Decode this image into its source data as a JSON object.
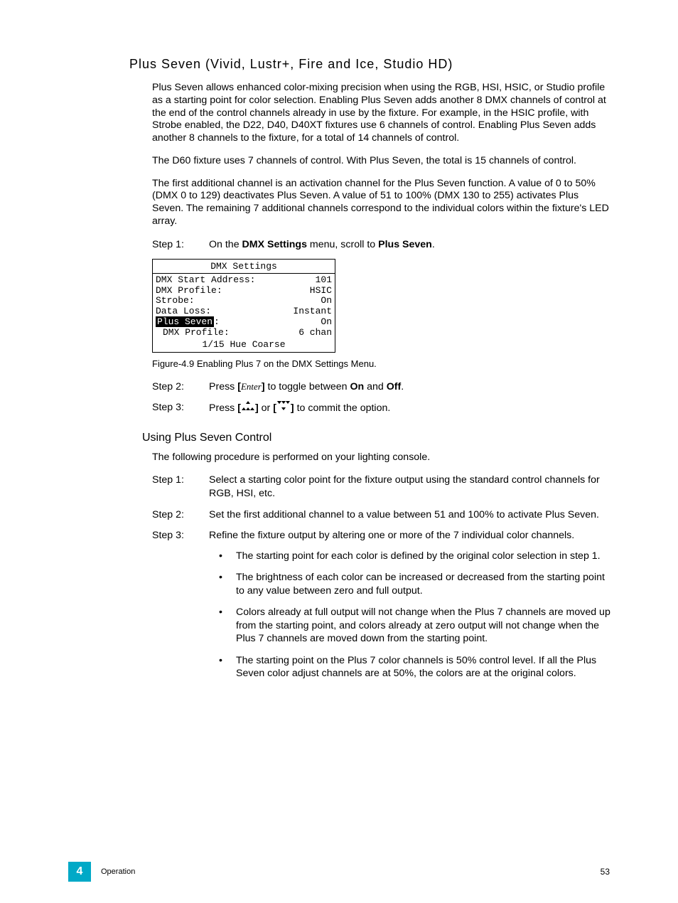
{
  "section_title": "Plus Seven (Vivid, Lustr+, Fire and Ice, Studio HD)",
  "para1": "Plus Seven allows enhanced color-mixing precision when using the RGB, HSI, HSIC, or Studio profile as a starting point for color selection. Enabling Plus Seven adds another 8 DMX channels of control at the end of the control channels already in use by the fixture. For example, in the HSIC profile, with Strobe enabled, the D22, D40, D40XT fixtures use 6 channels of control. Enabling Plus Seven adds another 8 channels to the fixture, for a total of 14 channels of control.",
  "para2": "The D60 fixture uses 7 channels of control. With Plus Seven, the total is 15 channels of control.",
  "para3": "The first additional channel is an activation channel for the Plus Seven function. A value of 0 to 50% (DMX 0 to 129) deactivates Plus Seven. A value of 51 to 100% (DMX 130 to 255) activates Plus Seven. The remaining 7 additional channels correspond to the individual colors within the fixture's LED array.",
  "stepA1": {
    "label": "Step 1:",
    "pre": "On the ",
    "b1": "DMX Settings",
    "mid": " menu, scroll to ",
    "b2": "Plus Seven",
    "post": "."
  },
  "dmx": {
    "title": "DMX Settings",
    "rows": [
      {
        "l": "DMX Start Address:",
        "r": "101"
      },
      {
        "l": "DMX Profile:",
        "r": "HSIC"
      },
      {
        "l": "Strobe:",
        "r": "On"
      },
      {
        "l": "Data Loss:",
        "r": "Instant"
      },
      {
        "l": "Plus Seven",
        "lr": ":",
        "r": "On",
        "hl": true
      },
      {
        "l": "DMX Profile:",
        "r": "6 chan",
        "indent": true
      }
    ],
    "footer": "1/15 Hue Coarse"
  },
  "figcap": "Figure-4.9 Enabling Plus 7 on the DMX Settings Menu.",
  "stepA2": {
    "label": "Step 2:",
    "pre": "Press ",
    "br1": "[",
    "enter": "Enter",
    "br2": "]",
    "mid": " to toggle between ",
    "b1": "On",
    "and": " and ",
    "b2": "Off",
    "post": "."
  },
  "stepA3": {
    "label": "Step 3:",
    "pre": "Press ",
    "b1": "[",
    "b2": "]",
    "or": " or ",
    "b3": "[",
    "b4": "]",
    "post": " to commit the option."
  },
  "subheading": "Using Plus Seven Control",
  "para4": "The following procedure is performed on your lighting console.",
  "stepB1": {
    "label": "Step 1:",
    "text": "Select a starting color point for the fixture output using the standard control channels for RGB, HSI, etc."
  },
  "stepB2": {
    "label": "Step 2:",
    "text": "Set the first additional channel to a value between 51 and 100% to activate Plus Seven."
  },
  "stepB3": {
    "label": "Step 3:",
    "text": "Refine the fixture output by altering one or more of the 7 individual color channels."
  },
  "bullets": [
    "The starting point for each color is defined by the original color selection in step 1.",
    "The brightness of each color can be increased or decreased from the starting point to any value between zero and full output.",
    "Colors already at full output will not change when the Plus 7 channels are moved up from the starting point, and colors already at zero output will not change when the Plus 7 channels are moved down from the starting point.",
    "The starting point on the Plus 7 color channels is 50% control level. If all the Plus Seven color adjust channels are at 50%, the colors are at the original colors."
  ],
  "footer": {
    "badge": "4",
    "text": "Operation",
    "page": "53"
  }
}
